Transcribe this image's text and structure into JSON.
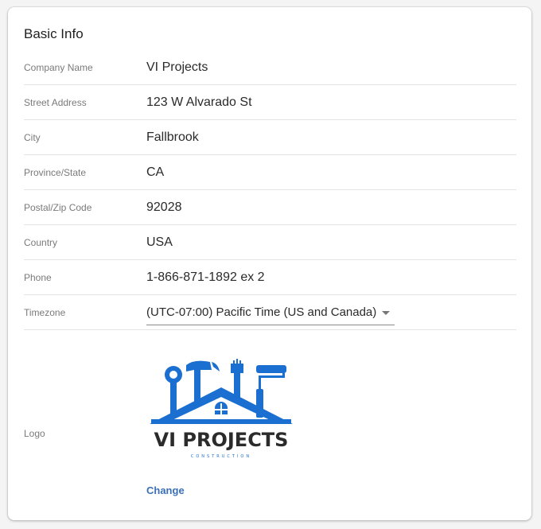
{
  "section": {
    "title": "Basic Info"
  },
  "fields": [
    {
      "label": "Company Name",
      "value": "VI Projects"
    },
    {
      "label": "Street Address",
      "value": "123 W Alvarado St"
    },
    {
      "label": "City",
      "value": "Fallbrook"
    },
    {
      "label": "Province/State",
      "value": "CA"
    },
    {
      "label": "Postal/Zip Code",
      "value": "92028"
    },
    {
      "label": "Country",
      "value": "USA"
    },
    {
      "label": "Phone",
      "value": "1-866-871-1892 ex 2"
    }
  ],
  "timezone": {
    "label": "Timezone",
    "selected": "(UTC-07:00) Pacific Time (US and Canada)"
  },
  "logo": {
    "label": "Logo",
    "brand_name": "VI PROJECTS",
    "brand_tagline": "CONSTRUCTION",
    "brand_color": "#1a6fd1",
    "text_color": "#2b2b2b",
    "change_label": "Change"
  }
}
